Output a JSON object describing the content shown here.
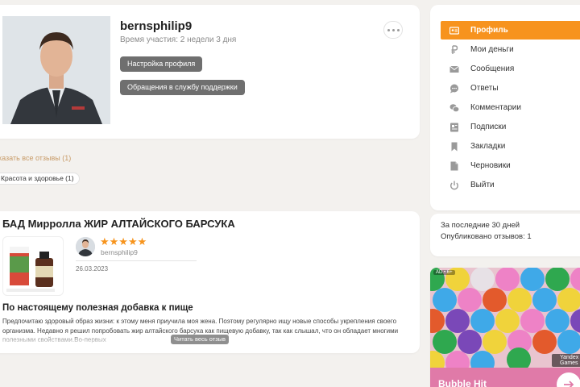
{
  "profile": {
    "username": "bernsphilip9",
    "member_since": "Время участия: 2 недели 3 дня",
    "settings_button": "Настройка профиля",
    "support_button": "Обращения в службу поддержки"
  },
  "filters": {
    "show_all": "казать все отзывы (1)",
    "category": "Красота и здоровье (1)"
  },
  "review": {
    "product_title": "БАД Мирролла ЖИР АЛТАЙСКОГО БАРСУКА",
    "rating": 5,
    "stars": "★★★★★",
    "reviewer": "bernsphilip9",
    "date": "26.03.2023",
    "heading": "По настоящему полезная добавка к пище",
    "text": "Предпочитаю здоровый образ жизни: к этому меня приучила моя жена. Поэтому регулярно ищу новые способы укрепления своего организма. Недавно я решил попробовать жир алтайского барсука как пищевую добавку, так как слышал, что он обладает многими полезными свойствами.Во-первых",
    "read_more": "Читать весь отзыв"
  },
  "sidebar": {
    "items": [
      {
        "label": "Профиль",
        "icon": "profile-card-icon",
        "active": true
      },
      {
        "label": "Мои деньги",
        "icon": "ruble-icon",
        "active": false
      },
      {
        "label": "Сообщения",
        "icon": "envelope-icon",
        "active": false
      },
      {
        "label": "Ответы",
        "icon": "speech-bubble-icon",
        "active": false
      },
      {
        "label": "Комментарии",
        "icon": "comments-icon",
        "active": false
      },
      {
        "label": "Подписки",
        "icon": "subscriptions-icon",
        "active": false
      },
      {
        "label": "Закладки",
        "icon": "bookmark-icon",
        "active": false
      },
      {
        "label": "Черновики",
        "icon": "draft-icon",
        "active": false
      },
      {
        "label": "Выйти",
        "icon": "power-icon",
        "active": false
      }
    ]
  },
  "stats": {
    "period": "За последние 30 дней",
    "published": "Опубликовано отзывов: 1"
  },
  "ad": {
    "badge": "AD • 6+",
    "yandex": "Yandex Games",
    "title": "Bubble Hit"
  },
  "colors": {
    "accent": "#f7931e",
    "background": "#f3f1ee",
    "star": "#f7941d",
    "link": "#c89b68"
  }
}
